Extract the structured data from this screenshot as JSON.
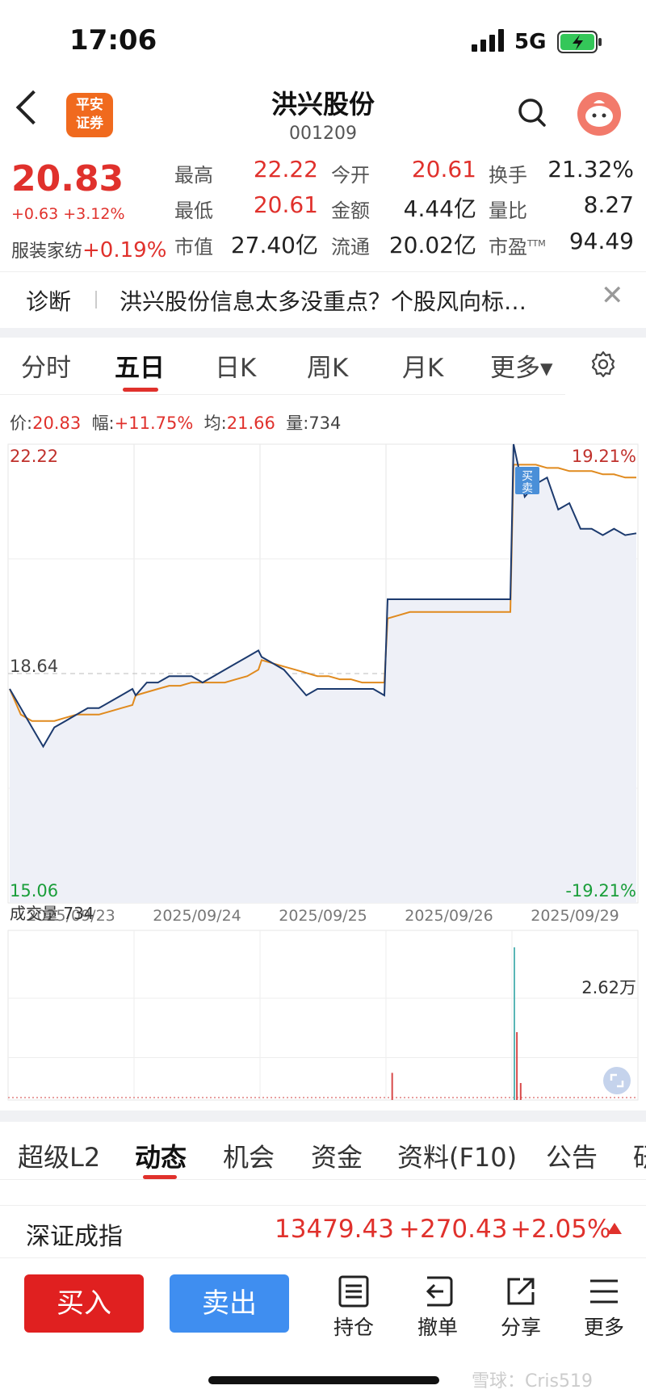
{
  "status_bar": {
    "time": "17:06",
    "network": "5G"
  },
  "nav": {
    "logo_text": "平安\n证券",
    "stock_name": "洪兴股份",
    "stock_code": "001209"
  },
  "quote": {
    "price": "20.83",
    "change": "+0.63 +3.12%",
    "industry_label": "服装家纺",
    "industry_change": "+0.19%",
    "fields": [
      {
        "label": "最高",
        "value": "22.22",
        "color": "#e0312c"
      },
      {
        "label": "今开",
        "value": "20.61",
        "color": "#e0312c"
      },
      {
        "label": "换手",
        "value": "21.32%",
        "color": "#222222"
      },
      {
        "label": "最低",
        "value": "20.61",
        "color": "#e0312c"
      },
      {
        "label": "金额",
        "value": "4.44亿",
        "color": "#222222"
      },
      {
        "label": "量比",
        "value": "8.27",
        "color": "#222222"
      },
      {
        "label": "市值",
        "value": "27.40亿",
        "color": "#222222"
      },
      {
        "label": "流通",
        "value": "20.02亿",
        "color": "#222222"
      },
      {
        "label": "市盈",
        "label_sup": "TTM",
        "value": "94.49",
        "color": "#222222"
      }
    ]
  },
  "diagnosis": {
    "label": "诊断",
    "text": "洪兴股份信息太多没重点？个股风向标…"
  },
  "chart_tabs": [
    "分时",
    "五日",
    "日K",
    "周K",
    "月K",
    "更多"
  ],
  "chart_tabs_active": "五日",
  "info_row": {
    "price_label": "价:",
    "price": "20.83",
    "amp_label": "幅:",
    "amp": "+11.75%",
    "avg_label": "均:",
    "avg": "21.66",
    "vol_label": "量:",
    "vol": "734"
  },
  "chart_data": {
    "type": "line",
    "title": "",
    "y_labels": {
      "top": "22.22",
      "mid": "18.64",
      "bottom": "15.06",
      "top_pct": "19.21%",
      "bottom_pct": "-19.21%"
    },
    "ylim": [
      15.06,
      22.22
    ],
    "x_dates": [
      "2025/09/23",
      "2025/09/24",
      "2025/09/25",
      "2025/09/26",
      "2025/09/29"
    ],
    "series": [
      {
        "name": "",
        "color": "#1c3a6e",
        "days": [
          [
            18.4,
            18.1,
            17.8,
            17.5,
            17.8,
            17.9,
            18.0,
            18.1,
            18.1,
            18.2,
            18.3,
            18.4
          ],
          [
            18.3,
            18.5,
            18.5,
            18.6,
            18.6,
            18.6,
            18.5,
            18.6,
            18.7,
            18.8,
            18.9,
            19.0
          ],
          [
            18.9,
            18.8,
            18.7,
            18.5,
            18.3,
            18.4,
            18.4,
            18.4,
            18.4,
            18.4,
            18.4,
            18.3
          ],
          [
            19.8,
            19.8,
            19.8,
            19.8,
            19.8,
            19.8,
            19.8,
            19.8,
            19.8,
            19.8,
            19.8,
            19.8
          ],
          [
            22.22,
            21.4,
            21.6,
            21.7,
            21.2,
            21.3,
            20.9,
            20.9,
            20.8,
            20.9,
            20.8,
            20.83
          ]
        ]
      },
      {
        "name": "",
        "color": "#e08a1e",
        "days": [
          [
            18.4,
            18.0,
            17.9,
            17.9,
            17.9,
            17.95,
            18.0,
            18.0,
            18.0,
            18.05,
            18.1,
            18.15
          ],
          [
            18.3,
            18.35,
            18.4,
            18.45,
            18.45,
            18.5,
            18.5,
            18.5,
            18.5,
            18.55,
            18.6,
            18.7
          ],
          [
            18.85,
            18.8,
            18.75,
            18.7,
            18.65,
            18.6,
            18.6,
            18.55,
            18.55,
            18.5,
            18.5,
            18.5
          ],
          [
            19.5,
            19.55,
            19.6,
            19.6,
            19.6,
            19.6,
            19.6,
            19.6,
            19.6,
            19.6,
            19.6,
            19.6
          ],
          [
            21.9,
            21.9,
            21.9,
            21.85,
            21.85,
            21.8,
            21.8,
            21.8,
            21.75,
            21.75,
            21.7,
            21.7
          ]
        ]
      }
    ],
    "marker_labels": [
      "买",
      "卖"
    ],
    "volume": {
      "label": "成交量",
      "value": "734",
      "max_label": "2.62万",
      "spikes": [
        {
          "day": 3,
          "pos": 0.03,
          "height": 0.16
        },
        {
          "day": 4,
          "pos": 0.0,
          "height": 0.9
        },
        {
          "day": 4,
          "pos": 0.02,
          "height": 0.4
        },
        {
          "day": 4,
          "pos": 0.05,
          "height": 0.1
        }
      ]
    }
  },
  "bottom_tabs": [
    "超级L2",
    "动态",
    "机会",
    "资金",
    "资料(F10)",
    "公告",
    "研"
  ],
  "bottom_tabs_active": "动态",
  "index_row": {
    "name": "深证成指",
    "value": "13479.43",
    "change": "+270.43",
    "pct": "+2.05%"
  },
  "actions": {
    "buy": "买入",
    "sell": "卖出",
    "items": [
      "持仓",
      "撤单",
      "分享",
      "更多"
    ]
  },
  "watermark": "雪球：Cris519"
}
